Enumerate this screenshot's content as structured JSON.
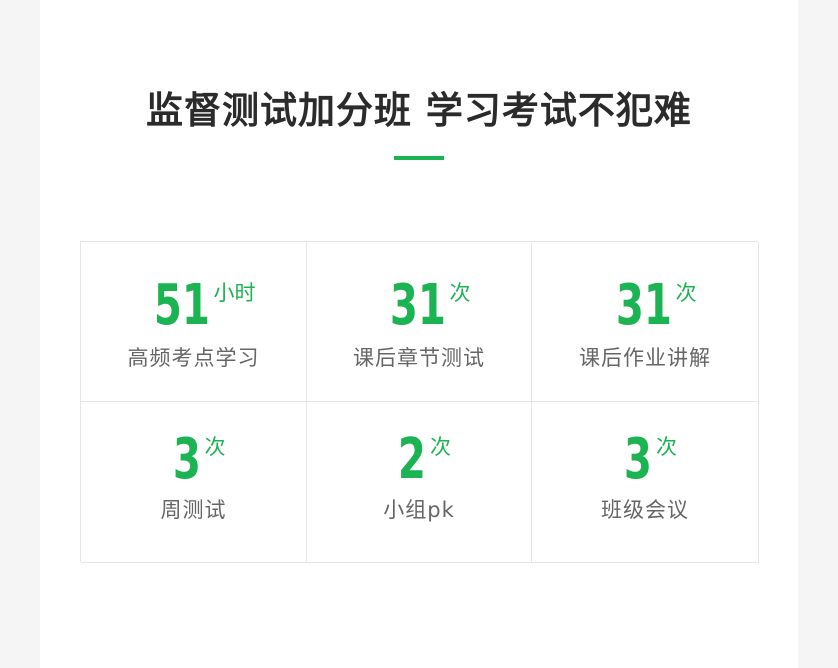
{
  "title": "监督测试加分班 学习考试不犯难",
  "colors": {
    "accent": "#1cb352",
    "text": "#2b2b2b",
    "label": "#666666",
    "border": "#e6e6e6"
  },
  "stats": [
    {
      "number": "51",
      "unit": "小时",
      "label": "高频考点学习"
    },
    {
      "number": "31",
      "unit": "次",
      "label": "课后章节测试"
    },
    {
      "number": "31",
      "unit": "次",
      "label": "课后作业讲解"
    },
    {
      "number": "3",
      "unit": "次",
      "label": "周测试"
    },
    {
      "number": "2",
      "unit": "次",
      "label": "小组pk"
    },
    {
      "number": "3",
      "unit": "次",
      "label": "班级会议"
    }
  ]
}
